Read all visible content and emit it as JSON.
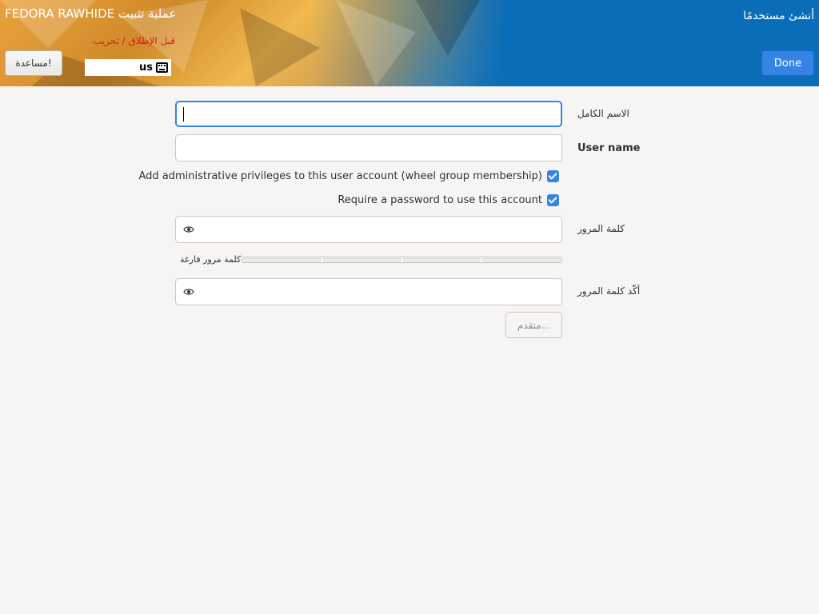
{
  "header": {
    "product_title": "FEDORA RAWHIDE عملية تثبيت",
    "prerelease_label": "قبل الإطلاق / تجريب",
    "help_label": "مساعدة!",
    "keyboard_layout": "us",
    "screen_title": "أنشئ مستخدمًا",
    "done_label": "Done"
  },
  "form": {
    "full_name_label": "الاسم الكامل",
    "full_name_value": "",
    "username_label": "User name",
    "username_value": "",
    "admin_checkbox_label": "Add administrative privileges to this user account (wheel group membership)",
    "admin_checked": true,
    "require_password_label": "Require a password to use this account",
    "require_password_checked": true,
    "password_label": "كلمة المرور",
    "password_value": "",
    "strength_text": "كلمة مرور فارغة",
    "strength_level": 0,
    "confirm_label": "أكّد كلمة المرور",
    "confirm_value": "",
    "advanced_label": "متقدم..."
  },
  "colors": {
    "accent": "#3584e4",
    "header_blue": "#0a6db8",
    "prerelease_red": "#e01b24",
    "background": "#f6f5f4"
  },
  "icons": {
    "keyboard": "keyboard-icon",
    "reveal_password": "eye-icon",
    "checkbox": "checkmark-icon"
  }
}
